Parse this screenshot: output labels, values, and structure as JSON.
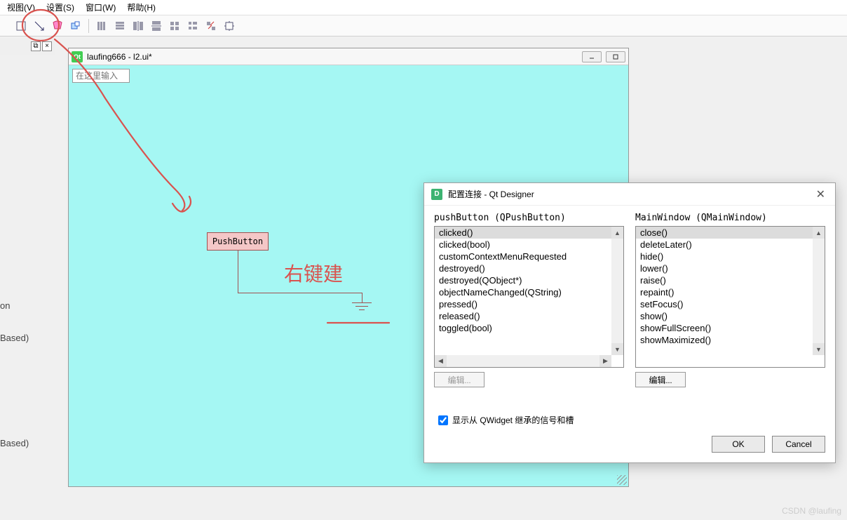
{
  "menu": {
    "view": "视图(V)",
    "settings": "设置(S)",
    "window": "窗口(W)",
    "help": "帮助(H)"
  },
  "left_frags": {
    "on": "on",
    "based1": "Based)",
    "based2": "Based)"
  },
  "canvas": {
    "title": "laufing666 - l2.ui*",
    "input_placeholder": "在这里输入",
    "push_button": "PushButton",
    "annotation_text": "右键建"
  },
  "dialog": {
    "title": "配置连接 - Qt Designer",
    "left_label": "pushButton (QPushButton)",
    "right_label": "MainWindow (QMainWindow)",
    "signals": [
      "clicked()",
      "clicked(bool)",
      "customContextMenuRequested",
      "destroyed()",
      "destroyed(QObject*)",
      "objectNameChanged(QString)",
      "pressed()",
      "released()",
      "toggled(bool)"
    ],
    "slots": [
      "close()",
      "deleteLater()",
      "hide()",
      "lower()",
      "raise()",
      "repaint()",
      "setFocus()",
      "show()",
      "showFullScreen()",
      "showMaximized()"
    ],
    "signal_selected": 0,
    "slot_selected": 0,
    "edit_label": "编辑...",
    "checkbox_label": "显示从 QWidget 继承的信号和槽",
    "checkbox_checked": true,
    "ok": "OK",
    "cancel": "Cancel"
  },
  "watermark": "CSDN @laufing"
}
